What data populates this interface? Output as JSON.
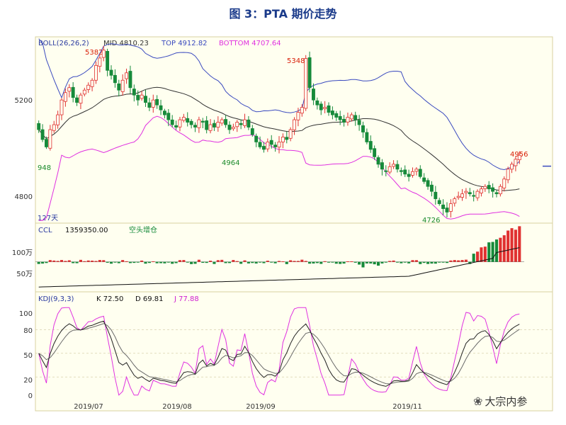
{
  "figure_title": "图 3：PTA 期价走势",
  "watermark": "大宗内参",
  "chart_data": [
    {
      "type": "candlestick",
      "panel": "price",
      "indicator_label": "BOLL(26,26,2)",
      "mid_label": "MID 4810.23",
      "top_label": "TOP 4912.82",
      "bottom_label": "BOTTOM 4707.64",
      "y_ticks": [
        "5200",
        "4800"
      ],
      "ylim": [
        4690,
        5430
      ],
      "annotations": [
        {
          "text": "5382",
          "color": "#d81e06"
        },
        {
          "text": "5348",
          "color": "#d81e06"
        },
        {
          "text": "4956",
          "color": "#d81e06"
        },
        {
          "text": "4964",
          "color": "#1a8a2a"
        },
        {
          "text": "4726",
          "color": "#1a8a2a"
        },
        {
          "text": "948",
          "color": "#1a8a2a"
        }
      ],
      "period_label": "127天",
      "colors": {
        "up": "#e03030",
        "down": "#168a3a",
        "mid": "#333333",
        "top": "#3a4abf",
        "bottom": "#e030e0"
      },
      "close_approx": [
        5060,
        5020,
        4990,
        5060,
        5080,
        5120,
        5180,
        5210,
        5230,
        5190,
        5170,
        5200,
        5220,
        5240,
        5260,
        5320,
        5350,
        5382,
        5300,
        5280,
        5250,
        5220,
        5260,
        5290,
        5230,
        5200,
        5180,
        5200,
        5170,
        5150,
        5180,
        5160,
        5140,
        5120,
        5100,
        5080,
        5070,
        5100,
        5110,
        5090,
        5080,
        5070,
        5100,
        5090,
        5060,
        5080,
        5070,
        5090,
        5100,
        5080,
        5060,
        5070,
        5090,
        5080,
        5100,
        5070,
        5040,
        5010,
        4990,
        4980,
        5010,
        5000,
        4990,
        5010,
        5030,
        5020,
        5060,
        5100,
        5130,
        5150,
        5348,
        5230,
        5180,
        5160,
        5140,
        5150,
        5130,
        5120,
        5110,
        5100,
        5090,
        5110,
        5120,
        5100,
        5080,
        5050,
        5010,
        4980,
        4950,
        4920,
        4900,
        4890,
        4910,
        4920,
        4900,
        4890,
        4880,
        4870,
        4890,
        4900,
        4870,
        4850,
        4830,
        4810,
        4780,
        4760,
        4740,
        4726,
        4760,
        4780,
        4790,
        4800,
        4810,
        4800,
        4790,
        4810,
        4820,
        4830,
        4820,
        4810,
        4800,
        4830,
        4860,
        4900,
        4920,
        4940,
        4956
      ]
    },
    {
      "type": "bar",
      "panel": "volume",
      "indicator_label": "CCL",
      "value_label": "1359350.00",
      "extra_label": "空头增仓",
      "y_ticks": [
        "100万",
        "50万"
      ],
      "ylim": [
        20,
        130
      ],
      "colors": {
        "up": "#e03030",
        "down": "#168a3a",
        "line": "#111111"
      }
    },
    {
      "type": "line",
      "panel": "indicator",
      "indicator_label": "KDJ(9,3,3)",
      "series_labels": [
        {
          "text": "K 72.50",
          "color": "#111111"
        },
        {
          "text": "D 69.81",
          "color": "#111111"
        },
        {
          "text": "J 77.88",
          "color": "#d020d0"
        }
      ],
      "y_ticks": [
        "100",
        "80",
        "50",
        "20",
        "0"
      ],
      "ylim": [
        -5,
        110
      ],
      "colors": {
        "K": "#222222",
        "D": "#6a6a6a",
        "J": "#e030e0"
      },
      "x_ticks": [
        "2019/07",
        "2019/08",
        "2019/09",
        "2019/11"
      ]
    }
  ]
}
